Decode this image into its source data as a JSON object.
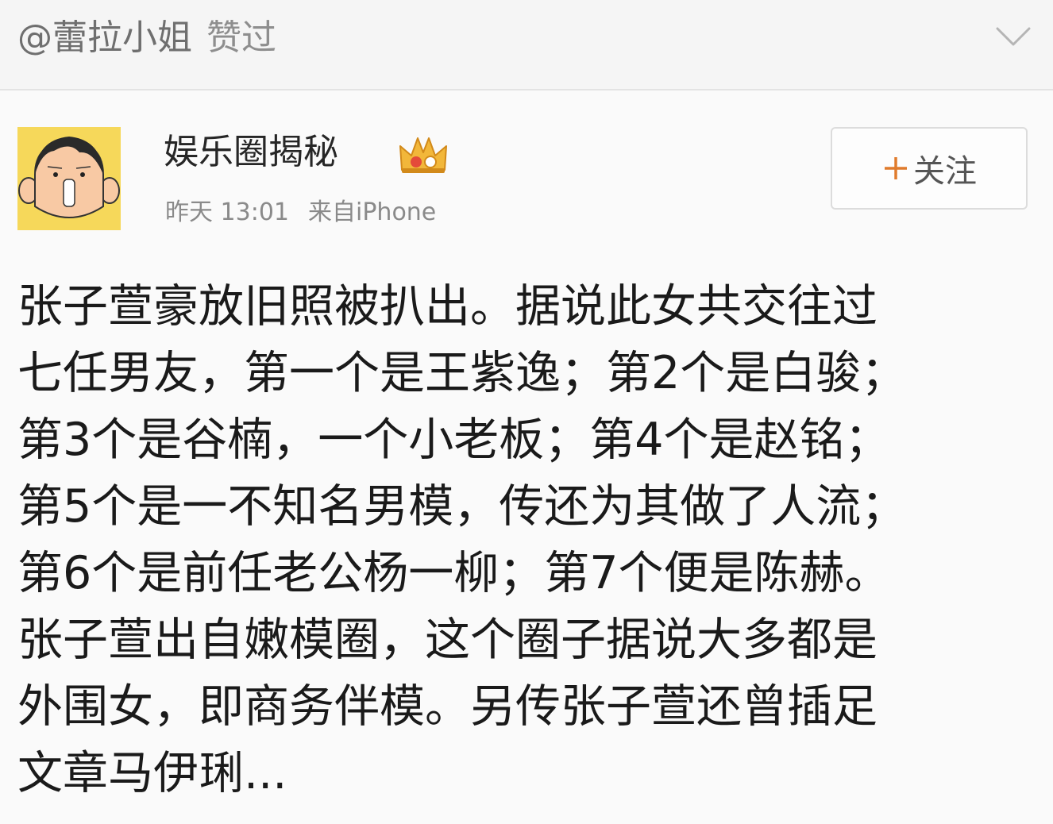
{
  "liked_header": {
    "user": "@蕾拉小姐",
    "action": "赞过"
  },
  "post": {
    "author": "娱乐圈揭秘",
    "time": "昨天 13:01",
    "source": "来自iPhone",
    "follow_label": "关注",
    "body_lines": [
      "张子萱豪放旧照被扒出。据说此女共交往过",
      "七任男友，第一个是王紫逸；第2个是白骏；",
      "第3个是谷楠，一个小老板；第4个是赵铭；",
      "第5个是一不知名男模，传还为其做了人流；",
      "第6个是前任老公杨一柳；第7个便是陈赫。",
      "张子萱出自嫩模圈，这个圈子据说大多都是",
      "外围女，即商务伴模。另传张子萱还曾插足",
      "文章马伊琍..."
    ]
  },
  "icons": {
    "expand": "chevron-down-icon",
    "vip": "crown-icon",
    "follow": "plus-icon",
    "avatar": "cartoon-avatar"
  },
  "colors": {
    "background": "#f7f7f7",
    "meta_text": "#8a8a8a",
    "avatar_bg": "#f6d85a"
  }
}
